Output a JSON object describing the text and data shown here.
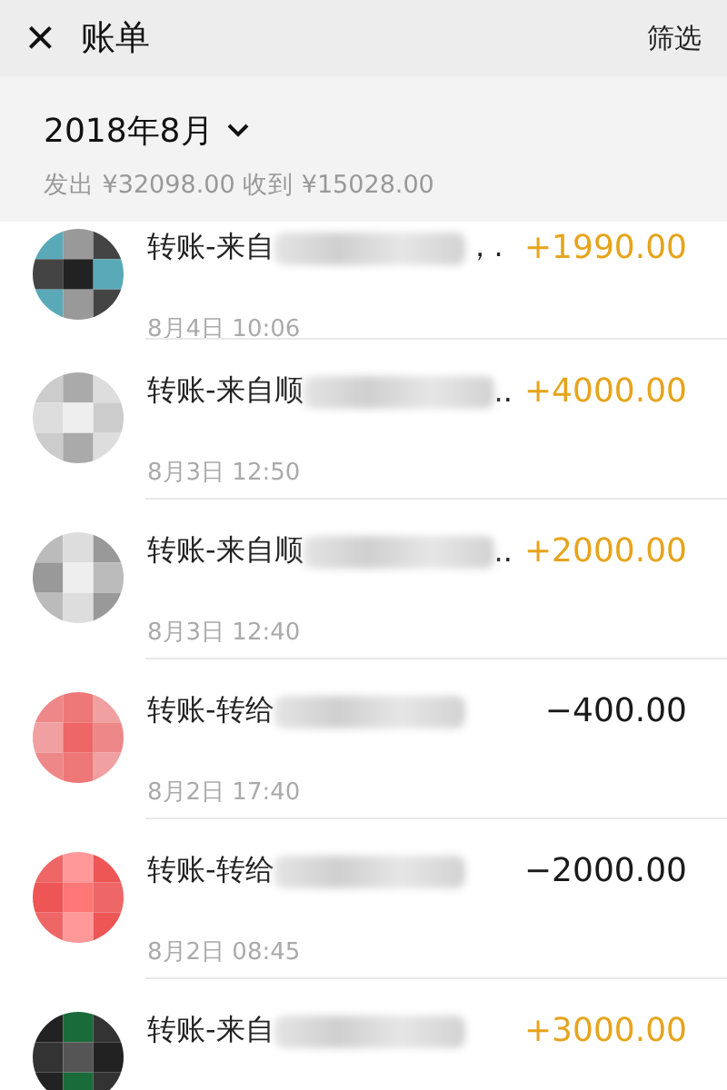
{
  "header": {
    "close": "×",
    "title": "账单",
    "filter": "筛选"
  },
  "summary": {
    "month": "2018年8月",
    "totals": "发出 ¥32098.00 收到 ¥15028.00"
  },
  "transactions": [
    {
      "title": "转账-来自",
      "tail": "，.",
      "time": "8月4日 10:06",
      "amount": "+1990.00",
      "kind": "income"
    },
    {
      "title": "转账-来自顺",
      "tail": "..",
      "time": "8月3日 12:50",
      "amount": "+4000.00",
      "kind": "income"
    },
    {
      "title": "转账-来自顺",
      "tail": "..",
      "time": "8月3日 12:40",
      "amount": "+2000.00",
      "kind": "income"
    },
    {
      "title": "转账-转给",
      "time": "8月2日 17:40",
      "amount": "−400.00",
      "kind": "expense"
    },
    {
      "title": "转账-转给",
      "time": "8月2日 08:45",
      "amount": "−2000.00",
      "kind": "expense"
    },
    {
      "title": "转账-来自",
      "amount": "+3000.00",
      "kind": "income"
    }
  ]
}
